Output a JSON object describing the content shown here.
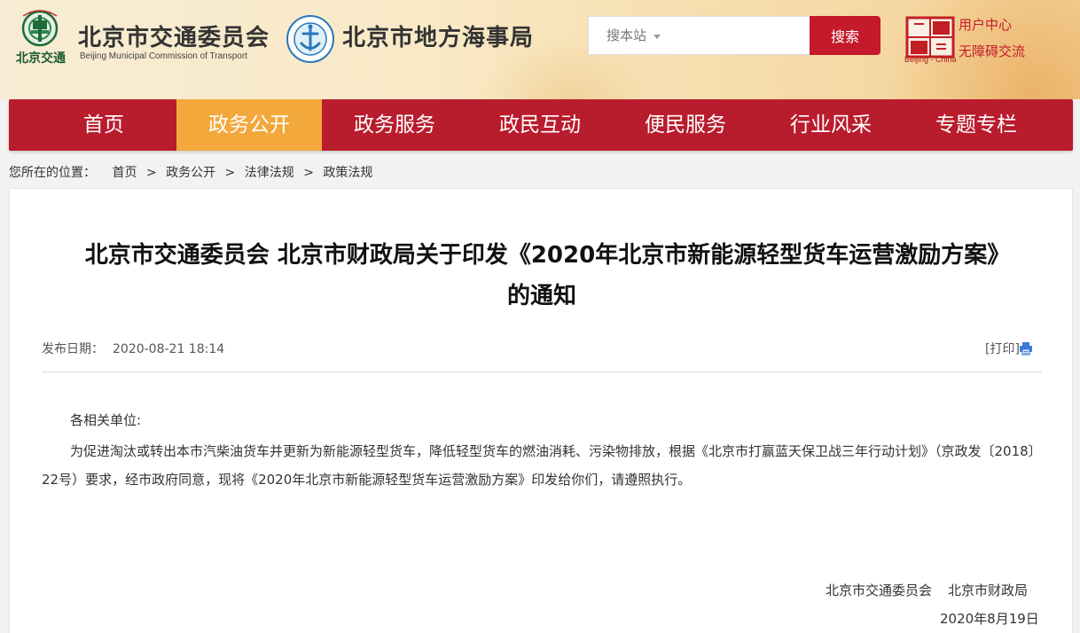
{
  "header": {
    "logo1_text": "北京交通",
    "brand1_cn": "北京市交通委员会",
    "brand1_en": "Beijing Municipal Commission of Transport",
    "brand2_cn": "北京市地方海事局",
    "search_placeholder": "搜本站",
    "search_button": "搜索",
    "seal_caption": "Beijing - China",
    "user_center": "用户中心",
    "accessible": "无障碍交流",
    "icons": [
      "transport-logo-icon",
      "maritime-logo-icon",
      "capital-seal-icon"
    ]
  },
  "nav": {
    "items": [
      {
        "label": "首页",
        "active": false
      },
      {
        "label": "政务公开",
        "active": true
      },
      {
        "label": "政务服务",
        "active": false
      },
      {
        "label": "政民互动",
        "active": false
      },
      {
        "label": "便民服务",
        "active": false
      },
      {
        "label": "行业风采",
        "active": false
      },
      {
        "label": "专题专栏",
        "active": false
      }
    ],
    "bg_color": "#b91c2d",
    "active_color": "#f3a83c"
  },
  "breadcrumb": {
    "prefix": "您所在的位置：",
    "items": [
      "首页",
      "政务公开",
      "法律法规",
      "政策法规"
    ],
    "separator": ">"
  },
  "article": {
    "title": "北京市交通委员会 北京市财政局关于印发《2020年北京市新能源轻型货车运营激励方案》的通知",
    "date_label": "发布日期：",
    "date_value": "2020-08-21 18:14",
    "print_label": "[打印]",
    "salutation": "各相关单位:",
    "body": "为促进淘汰或转出本市汽柴油货车并更新为新能源轻型货车，降低轻型货车的燃油消耗、污染物排放，根据《北京市打赢蓝天保卫战三年行动计划》（京政发〔2018〕22号）要求，经市政府同意，现将《2020年北京市新能源轻型货车运营激励方案》印发给你们，请遵照执行。",
    "signer1": "北京市交通委员会",
    "signer2": "北京市财政局",
    "sign_date": "2020年8月19日"
  }
}
